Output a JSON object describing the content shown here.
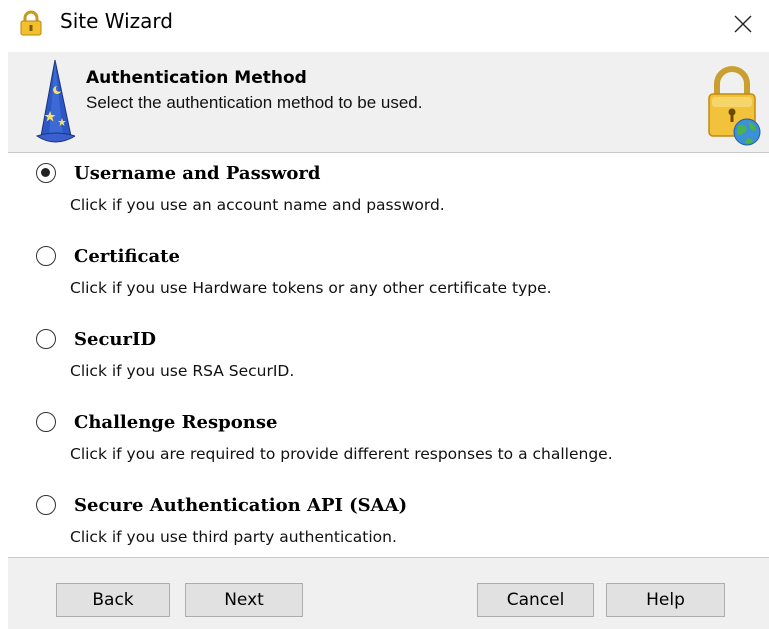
{
  "window": {
    "title": "Site Wizard"
  },
  "header": {
    "title": "Authentication Method",
    "subtitle": "Select the authentication method to be used."
  },
  "options": [
    {
      "label": "Username and Password",
      "description": "Click if you use an account name and password.",
      "selected": true
    },
    {
      "label": "Certificate",
      "description": "Click if you use Hardware tokens or any other certificate type.",
      "selected": false
    },
    {
      "label": "SecurID",
      "description": "Click if you use RSA SecurID.",
      "selected": false
    },
    {
      "label": "Challenge Response",
      "description": "Click if you are required to provide different responses to a challenge.",
      "selected": false
    },
    {
      "label": "Secure Authentication API (SAA)",
      "description": "Click if you use third party authentication.",
      "selected": false
    }
  ],
  "footer": {
    "back_label": "Back",
    "next_label": "Next",
    "cancel_label": "Cancel",
    "help_label": "Help"
  },
  "icons": {
    "app": "padlock-icon",
    "close": "close-icon",
    "wizard": "wizard-hat-icon",
    "lock": "lock-globe-icon"
  }
}
